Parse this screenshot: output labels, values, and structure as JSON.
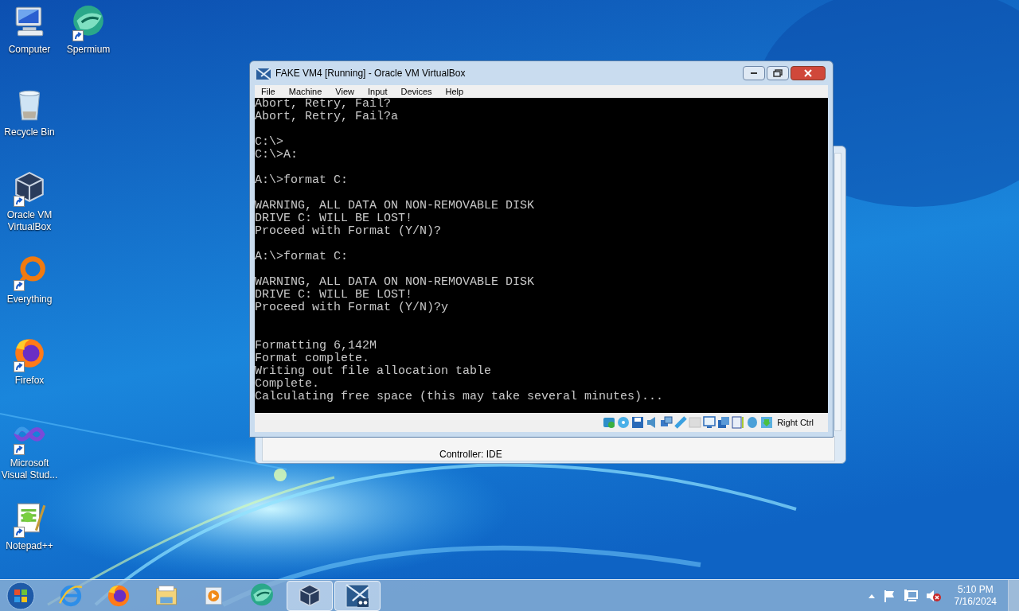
{
  "desktop_icons": [
    {
      "label": "Computer",
      "kind": "computer",
      "shortcut": false
    },
    {
      "label": "Spermium",
      "kind": "globe",
      "shortcut": true
    },
    {
      "label": "Recycle Bin",
      "kind": "bin",
      "shortcut": false
    },
    {
      "label": "Oracle VM VirtualBox",
      "kind": "box",
      "shortcut": true
    },
    {
      "label": "Everything",
      "kind": "ring",
      "shortcut": true
    },
    {
      "label": "Firefox",
      "kind": "fox",
      "shortcut": true
    },
    {
      "label": "Microsoft Visual Stud...",
      "kind": "infinity",
      "shortcut": true
    },
    {
      "label": "Notepad++",
      "kind": "notepad",
      "shortcut": true
    }
  ],
  "background_window": {
    "line": "Controller: IDE"
  },
  "window": {
    "title": "FAKE VM4 [Running] - Oracle VM VirtualBox",
    "menu": [
      "File",
      "Machine",
      "View",
      "Input",
      "Devices",
      "Help"
    ],
    "console": [
      {
        "lines": [
          "Abort, Retry, Fail?",
          "Abort, Retry, Fail?a"
        ]
      },
      {
        "kind": "gap",
        "lines": [
          "C:\\>",
          "C:\\>A:"
        ]
      },
      {
        "kind": "gap",
        "lines": [
          "A:\\>format C:"
        ]
      },
      {
        "kind": "gap",
        "lines": [
          "WARNING, ALL DATA ON NON-REMOVABLE DISK",
          "DRIVE C: WILL BE LOST!",
          "Proceed with Format (Y/N)?"
        ]
      },
      {
        "kind": "gap",
        "lines": [
          "A:\\>format C:"
        ]
      },
      {
        "kind": "gap",
        "lines": [
          "WARNING, ALL DATA ON NON-REMOVABLE DISK",
          "DRIVE C: WILL BE LOST!",
          "Proceed with Format (Y/N)?y"
        ]
      },
      {
        "kind": "wide_gap",
        "lines": [
          "Formatting 6,142M",
          "Format complete.",
          "Writing out file allocation table",
          "Complete.",
          "Calculating free space (this may take several minutes)..."
        ]
      }
    ],
    "host_key": "Right Ctrl"
  },
  "taskbar": {
    "items": [
      {
        "kind": "ie",
        "selected": false
      },
      {
        "kind": "fox",
        "selected": false
      },
      {
        "kind": "folder",
        "selected": false
      },
      {
        "kind": "media",
        "selected": false
      },
      {
        "kind": "globe",
        "selected": false
      },
      {
        "kind": "box",
        "selected": true
      },
      {
        "kind": "win98",
        "selected": true
      }
    ],
    "time": "5:10 PM",
    "date": "7/16/2024"
  }
}
